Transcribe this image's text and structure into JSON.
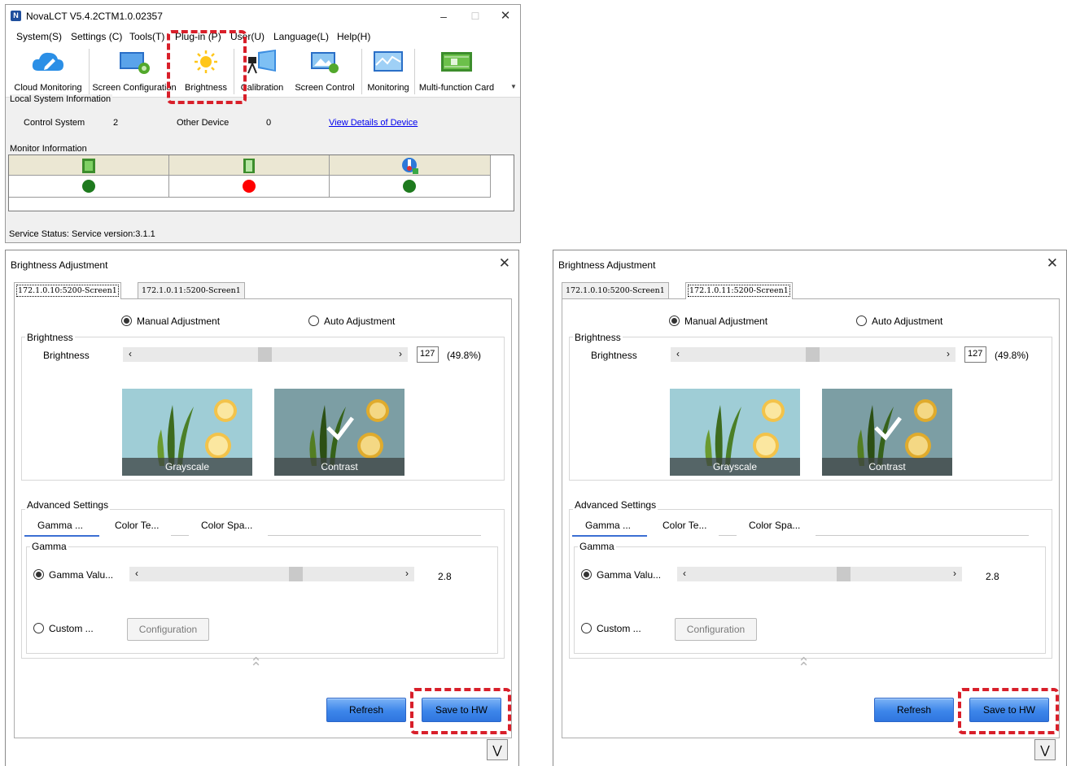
{
  "main_window": {
    "title": "NovaLCT V5.4.2CTM1.0.02357",
    "menu": [
      "System(S)",
      "Settings (C)",
      "Tools(T)",
      "Plug-in (P)",
      "User(U)",
      "Language(L)",
      "Help(H)"
    ],
    "toolbar": [
      "Cloud Monitoring",
      "Screen Configuration",
      "Brightness",
      "Calibration",
      "Screen Control",
      "Monitoring",
      "Multi-function Card"
    ],
    "local_system": {
      "label": "Local System Information",
      "control_system_label": "Control System",
      "control_system_value": "2",
      "other_device_label": "Other Device",
      "other_device_value": "0",
      "details_link": "View Details of Device"
    },
    "monitor": {
      "label": "Monitor Information",
      "status_colors": [
        "#1e7a1e",
        "#ff0000",
        "#1e7a1e"
      ]
    },
    "status_bar": "Service Status:  Service version:3.1.1"
  },
  "dialogs": [
    {
      "title": "Brightness Adjustment",
      "tabs": [
        "172.1.0.10:5200-Screen1",
        "172.1.0.11:5200-Screen1"
      ],
      "active_tab": 0,
      "manual_label": "Manual Adjustment",
      "auto_label": "Auto Adjustment",
      "brightness_group": "Brightness",
      "brightness_label": "Brightness",
      "brightness_value": "127",
      "brightness_percent": "(49.8%)",
      "brightness_fraction": 0.498,
      "grayscale_label": "Grayscale",
      "contrast_label": "Contrast",
      "advanced_label": "Advanced Settings",
      "adv_tabs": [
        "Gamma ...",
        "Color Te...",
        "Color Spa..."
      ],
      "gamma_group": "Gamma",
      "gamma_value_label": "Gamma Valu...",
      "gamma_value": "2.8",
      "gamma_fraction": 0.6,
      "custom_label": "Custom ...",
      "configuration_label": "Configuration",
      "refresh_label": "Refresh",
      "save_label": "Save to HW"
    },
    {
      "title": "Brightness Adjustment",
      "tabs": [
        "172.1.0.10:5200-Screen1",
        "172.1.0.11:5200-Screen1"
      ],
      "active_tab": 1,
      "manual_label": "Manual Adjustment",
      "auto_label": "Auto Adjustment",
      "brightness_group": "Brightness",
      "brightness_label": "Brightness",
      "brightness_value": "127",
      "brightness_percent": "(49.8%)",
      "brightness_fraction": 0.498,
      "grayscale_label": "Grayscale",
      "contrast_label": "Contrast",
      "advanced_label": "Advanced Settings",
      "adv_tabs": [
        "Gamma ...",
        "Color Te...",
        "Color Spa..."
      ],
      "gamma_group": "Gamma",
      "gamma_value_label": "Gamma Valu...",
      "gamma_value": "2.8",
      "gamma_fraction": 0.6,
      "custom_label": "Custom ...",
      "configuration_label": "Configuration",
      "refresh_label": "Refresh",
      "save_label": "Save to HW"
    }
  ]
}
